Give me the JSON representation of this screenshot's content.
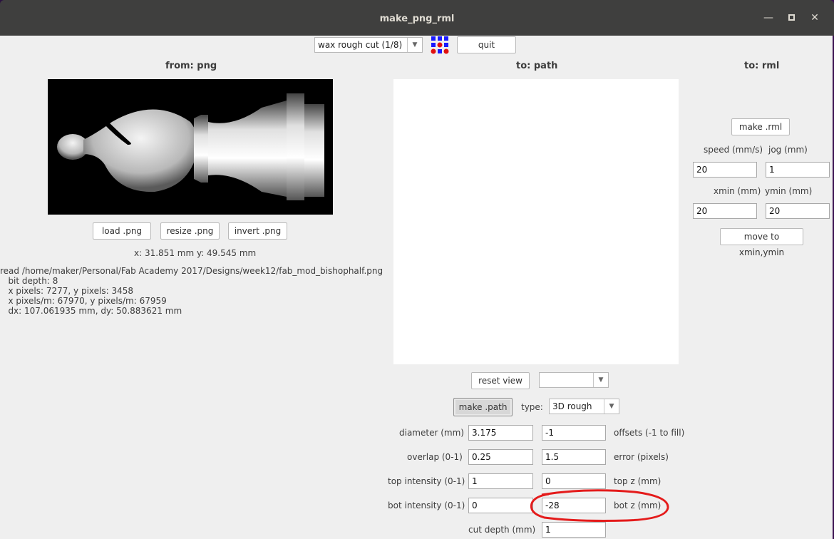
{
  "window": {
    "title": "make_png_rml"
  },
  "toolbar": {
    "process": "wax rough cut (1/8)",
    "quit": "quit"
  },
  "from_panel": {
    "header": "from: png",
    "load": "load .png",
    "resize": "resize .png",
    "invert": "invert .png",
    "xy": "x: 31.851 mm  y: 49.545 mm",
    "info": [
      "read /home/maker/Personal/Fab Academy 2017/Designs/week12/fab_mod_bishophalf.png",
      "   bit depth: 8",
      "   x pixels: 7277, y pixels: 3458",
      "   x pixels/m: 67970, y pixels/m: 67959",
      "   dx: 107.061935 mm, dy: 50.883621 mm"
    ]
  },
  "path_panel": {
    "header": "to: path",
    "reset_view": "reset view",
    "view_select": "",
    "make_path": "make .path",
    "type_label": "type:",
    "type_value": "3D rough",
    "fields": {
      "diameter_label": "diameter (mm)",
      "diameter": "3.175",
      "offsets": "-1",
      "offsets_label": "offsets (-1 to fill)",
      "overlap_label": "overlap (0-1)",
      "overlap": "0.25",
      "error": "1.5",
      "error_label": "error (pixels)",
      "top_intensity_label": "top intensity (0-1)",
      "top_intensity": "1",
      "top_z": "0",
      "top_z_label": "top z (mm)",
      "bot_intensity_label": "bot intensity (0-1)",
      "bot_intensity": "0",
      "bot_z": "-28",
      "bot_z_label": "bot z (mm)",
      "cut_depth_label": "cut depth (mm)",
      "cut_depth": "1"
    }
  },
  "rml_panel": {
    "header": "to: rml",
    "make_rml": "make .rml",
    "speed_label": "speed (mm/s)",
    "speed": "20",
    "jog_label": "jog (mm)",
    "jog": "1",
    "xmin_label": "xmin (mm)",
    "xmin": "20",
    "ymin_label": "ymin (mm)",
    "ymin": "20",
    "move": "move to xmin,ymin"
  }
}
